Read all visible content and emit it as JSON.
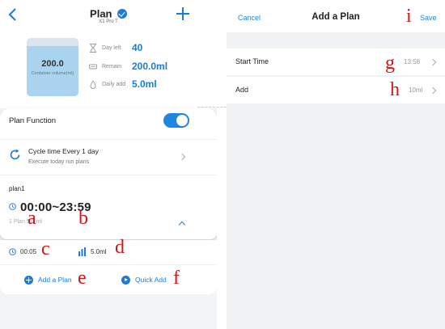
{
  "left": {
    "header": {
      "title": "Plan",
      "subtitle": "X1 Pro T"
    },
    "tank": {
      "value": "200.0",
      "label": "Container volume(ml)",
      "fill_fraction": 0.86
    },
    "stats": [
      {
        "icon": "hourglass-icon",
        "label": "Day left",
        "value": "40"
      },
      {
        "icon": "tank-icon",
        "label": "Remain",
        "value": "200.0ml"
      },
      {
        "icon": "drop-icon",
        "label": "Daily add",
        "value": "5.0ml"
      }
    ],
    "plan_function": {
      "label": "Plan Function",
      "enabled": true
    },
    "cycle": {
      "title": "Cycle time  Every 1 day",
      "subtitle": "Execute today run plans"
    },
    "plan": {
      "name": "plan1",
      "range": "00:00~23:59",
      "summary": "1 Plan   5.0 ml"
    },
    "entry": {
      "time": "00:05",
      "amount": "5.0ml"
    },
    "actions": {
      "add_plan": "Add a Plan",
      "quick_add": "Quick Add"
    }
  },
  "right": {
    "header": {
      "cancel": "Cancel",
      "title": "Add a Plan",
      "save": "Save"
    },
    "rows": [
      {
        "label": "Start Time",
        "value": "13:58"
      },
      {
        "label": "Add",
        "value": "10ml"
      }
    ]
  },
  "marks": {
    "a": "a",
    "b": "b",
    "c": "c",
    "d": "d",
    "e": "e",
    "f": "f",
    "g": "g",
    "h": "h",
    "i": "i"
  },
  "colors": {
    "accent": "#1d7bd8",
    "annotation": "#d11616"
  }
}
